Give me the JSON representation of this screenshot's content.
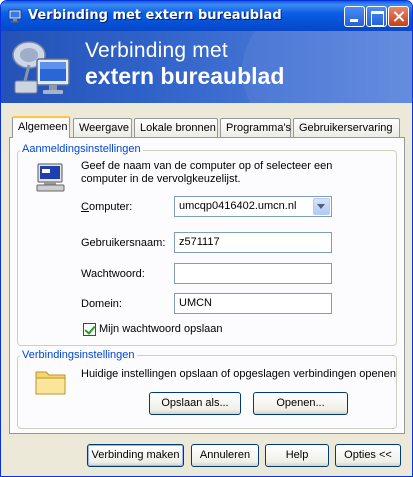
{
  "window": {
    "title": "Verbinding met extern bureaublad"
  },
  "banner": {
    "line1": "Verbinding met",
    "line2": "extern bureaublad"
  },
  "tabs": [
    {
      "label": "Algemeen",
      "active": true
    },
    {
      "label": "Weergave",
      "active": false
    },
    {
      "label": "Lokale bronnen",
      "active": false
    },
    {
      "label": "Programma's",
      "active": false
    },
    {
      "label": "Gebruikerservaring",
      "active": false
    }
  ],
  "login": {
    "legend": "Aanmeldingsinstellingen",
    "description": "Geef de naam van de computer op of selecteer een computer in de vervolgkeuzelijst.",
    "computer_label": "Computer:",
    "computer_value": "umcqp0416402.umcn.nl",
    "username_label": "Gebruikersnaam:",
    "username_value": "z571117",
    "password_label": "Wachtwoord:",
    "password_value": "",
    "domain_label": "Domein:",
    "domain_value": "UMCN",
    "save_password_label": "Mijn wachtwoord opslaan",
    "save_password_checked": true
  },
  "connection": {
    "legend": "Verbindingsinstellingen",
    "description": "Huidige instellingen opslaan of opgeslagen verbindingen openen",
    "save_as_label": "Opslaan als...",
    "open_label": "Openen..."
  },
  "footer": {
    "connect_label": "Verbinding maken",
    "cancel_label": "Annuleren",
    "help_label": "Help",
    "options_label": "Opties <<"
  }
}
